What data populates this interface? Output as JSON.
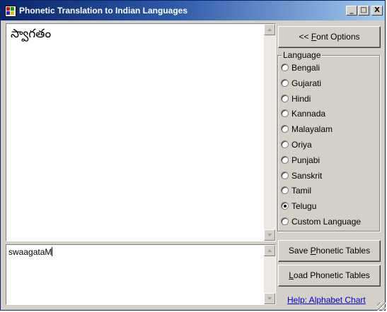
{
  "window": {
    "title": "Phonetic Translation to Indian Languages",
    "minimize_glyph": "_",
    "maximize_glyph": "□",
    "close_glyph": "X"
  },
  "output": {
    "text": "స్వాగతం"
  },
  "input": {
    "text": "swaagataM"
  },
  "font_options": {
    "prefix": "<< ",
    "accel": "F",
    "rest": "ont Options"
  },
  "language": {
    "legend": "Language",
    "options": [
      "Bengali",
      "Gujarati",
      "Hindi",
      "Kannada",
      "Malayalam",
      "Oriya",
      "Punjabi",
      "Sanskrit",
      "Tamil",
      "Telugu",
      "Custom Language"
    ],
    "selected": "Telugu"
  },
  "save_button": {
    "before": "Save ",
    "accel": "P",
    "after": "honetic Tables"
  },
  "load_button": {
    "before": "",
    "accel": "L",
    "after": "oad Phonetic Tables"
  },
  "help_link": "Help: Alphabet Chart"
}
